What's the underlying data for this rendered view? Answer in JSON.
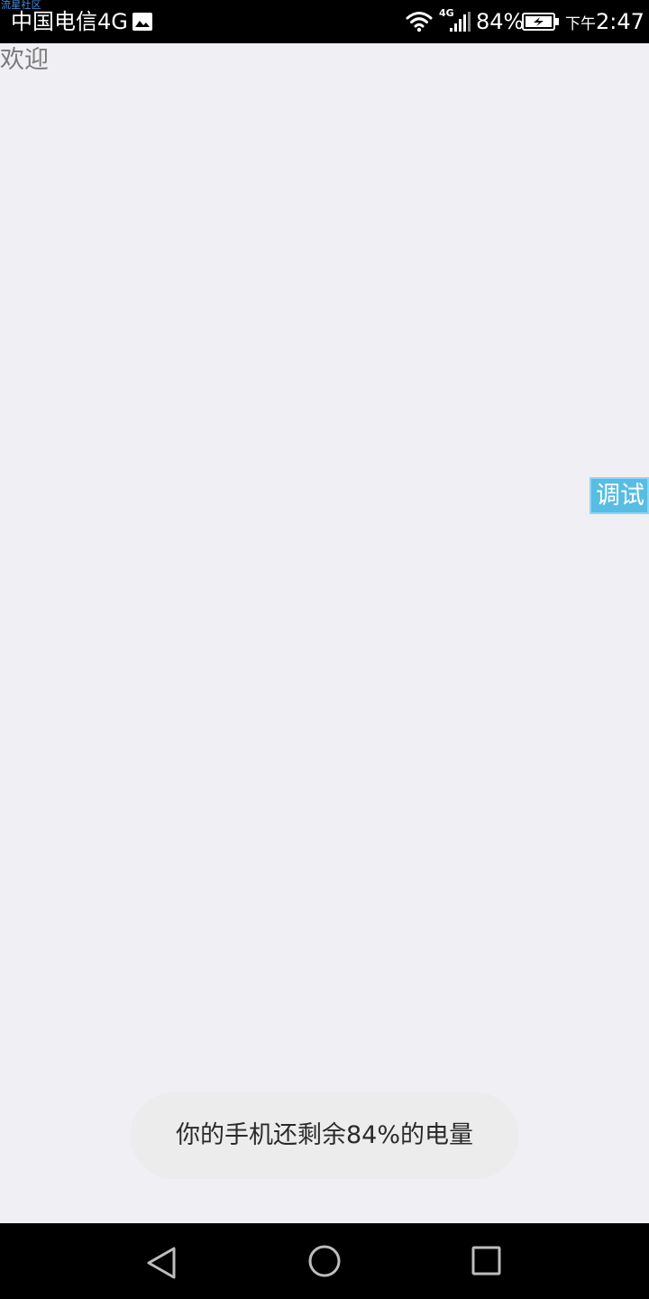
{
  "status_bar": {
    "watermark": "流星社区",
    "carrier": "中国电信4G",
    "network_type": "4G",
    "battery_percent": "84%",
    "time_period": "下午",
    "time": "2:47",
    "icons": [
      "image-icon",
      "wifi-icon",
      "signal-icon",
      "battery-charging-icon"
    ]
  },
  "content": {
    "welcome_text": "欢迎",
    "debug_button_label": "调试"
  },
  "toast": {
    "message": "你的手机还剩余84%的电量"
  },
  "navigation_bar": {
    "buttons": [
      "back-icon",
      "home-icon",
      "recents-icon"
    ]
  },
  "colors": {
    "background": "#efeff4",
    "status_bar": "#000000",
    "debug_button": "#57bde3",
    "toast_background": "#ececec"
  }
}
